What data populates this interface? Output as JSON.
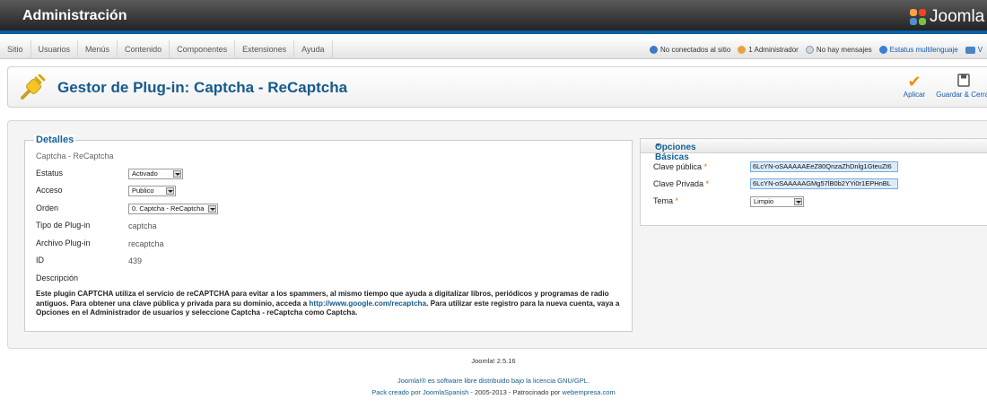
{
  "header": {
    "title": "Administración",
    "logo_text": "Joomla"
  },
  "menu": [
    "Sitio",
    "Usuarios",
    "Menús",
    "Contenido",
    "Componentes",
    "Extensiones",
    "Ayuda"
  ],
  "status": {
    "no_conectados": "No conectados al sitio",
    "administrador": "1 Administrador",
    "mensajes": "No hay mensajes",
    "multilenguaje": "Estatus multilenguaje",
    "ver": "V"
  },
  "toolbar": {
    "title": "Gestor de Plug-in: Captcha - ReCaptcha",
    "apply_label": "Aplicar",
    "save_close_label": "Guardar & Cerrar"
  },
  "detalles": {
    "legend": "Detalles",
    "subtitle": "Captcha - ReCaptcha",
    "estatus_label": "Estatus",
    "estatus_value": "Activado",
    "acceso_label": "Acceso",
    "acceso_value": "Publico",
    "orden_label": "Orden",
    "orden_value": "0. Captcha - ReCaptcha",
    "tipo_label": "Tipo de Plug-in",
    "tipo_value": "captcha",
    "archivo_label": "Archivo Plug-in",
    "archivo_value": "recaptcha",
    "id_label": "ID",
    "id_value": "439",
    "descripcion_label": "Descripción",
    "desc_part1": "Este plugin CAPTCHA utiliza el servicio de reCAPTCHA para evitar a los spammers, al mismo tiempo que ayuda a digitalizar libros, periódicos y programas de radio antiguos. Para obtener una clave pública y privada para su dominio, acceda a ",
    "desc_link": "http://www.google.com/recaptcha",
    "desc_part2": ". Para utilizar este registro para la nueva cuenta, vaya a Opciones en el Administrador de usuarios y seleccione Captcha - reCaptcha como Captcha."
  },
  "opciones": {
    "title": "Opciones Básicas",
    "clave_publica_label": "Clave pública",
    "clave_publica_value": "6LcYN-oSAAAAAEeZ80QnzaZhDnlg1GteuZt6",
    "clave_privada_label": "Clave Privada",
    "clave_privada_value": "6LcYN-oSAAAAAGMg57lB0b2YYi0r1EPHnBL",
    "tema_label": "Tema",
    "tema_value": "Limpio",
    "required_mark": "*"
  },
  "footer": {
    "version": "Joomla! 2.5.16",
    "license": "Joomla!® es software libre distribuido bajo la licencia GNU/GPL.",
    "pack_prefix": "Pack creado por",
    "pack_link": "JoomlaSpanish",
    "pack_mid": "- 2005-2013 - Patrocinado por",
    "sponsor_link": "webempresa.com"
  },
  "colors": {
    "accent": "#145a8c",
    "header_bar": "#0b5fa5",
    "required": "#e36c09"
  }
}
